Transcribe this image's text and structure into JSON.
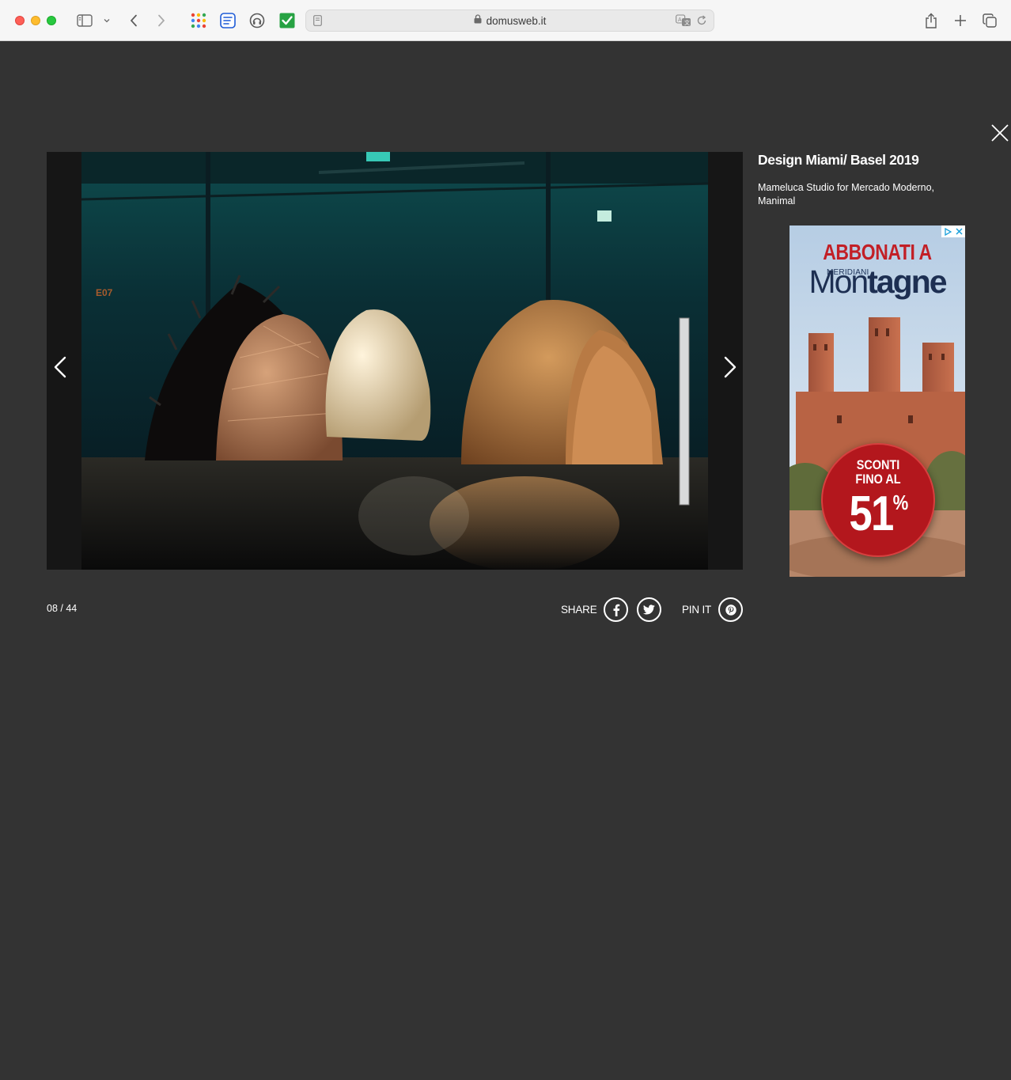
{
  "browser": {
    "url": "domusweb.it",
    "icons": [
      "sidebar-icon",
      "chevron-down-icon",
      "back-icon",
      "forward-icon",
      "apps-grid-icon",
      "notes-extension-icon",
      "headphones-extension-icon",
      "checkmark-extension-icon",
      "reader-icon",
      "lock-icon",
      "translate-icon",
      "reload-icon",
      "share-icon",
      "new-tab-icon",
      "tab-overview-icon"
    ]
  },
  "gallery": {
    "counter": "08 / 44",
    "share_label": "SHARE",
    "pin_label": "PIN IT",
    "title": "Design Miami/ Basel 2019",
    "caption": "Mameluca Studio for Mercado Moderno, Manimal",
    "photo_sign": "E07"
  },
  "ad": {
    "headline": "ABBONATI A",
    "brand_small": "MERIDIANI",
    "brand_thin": "Mon",
    "brand_bold": "tagne",
    "badge_line1": "SCONTI",
    "badge_line2": "FINO AL",
    "badge_number": "51",
    "badge_percent": "%"
  },
  "colors": {
    "background": "#333333",
    "ad_red": "#b3171d",
    "ad_navy": "#1d2f52"
  }
}
